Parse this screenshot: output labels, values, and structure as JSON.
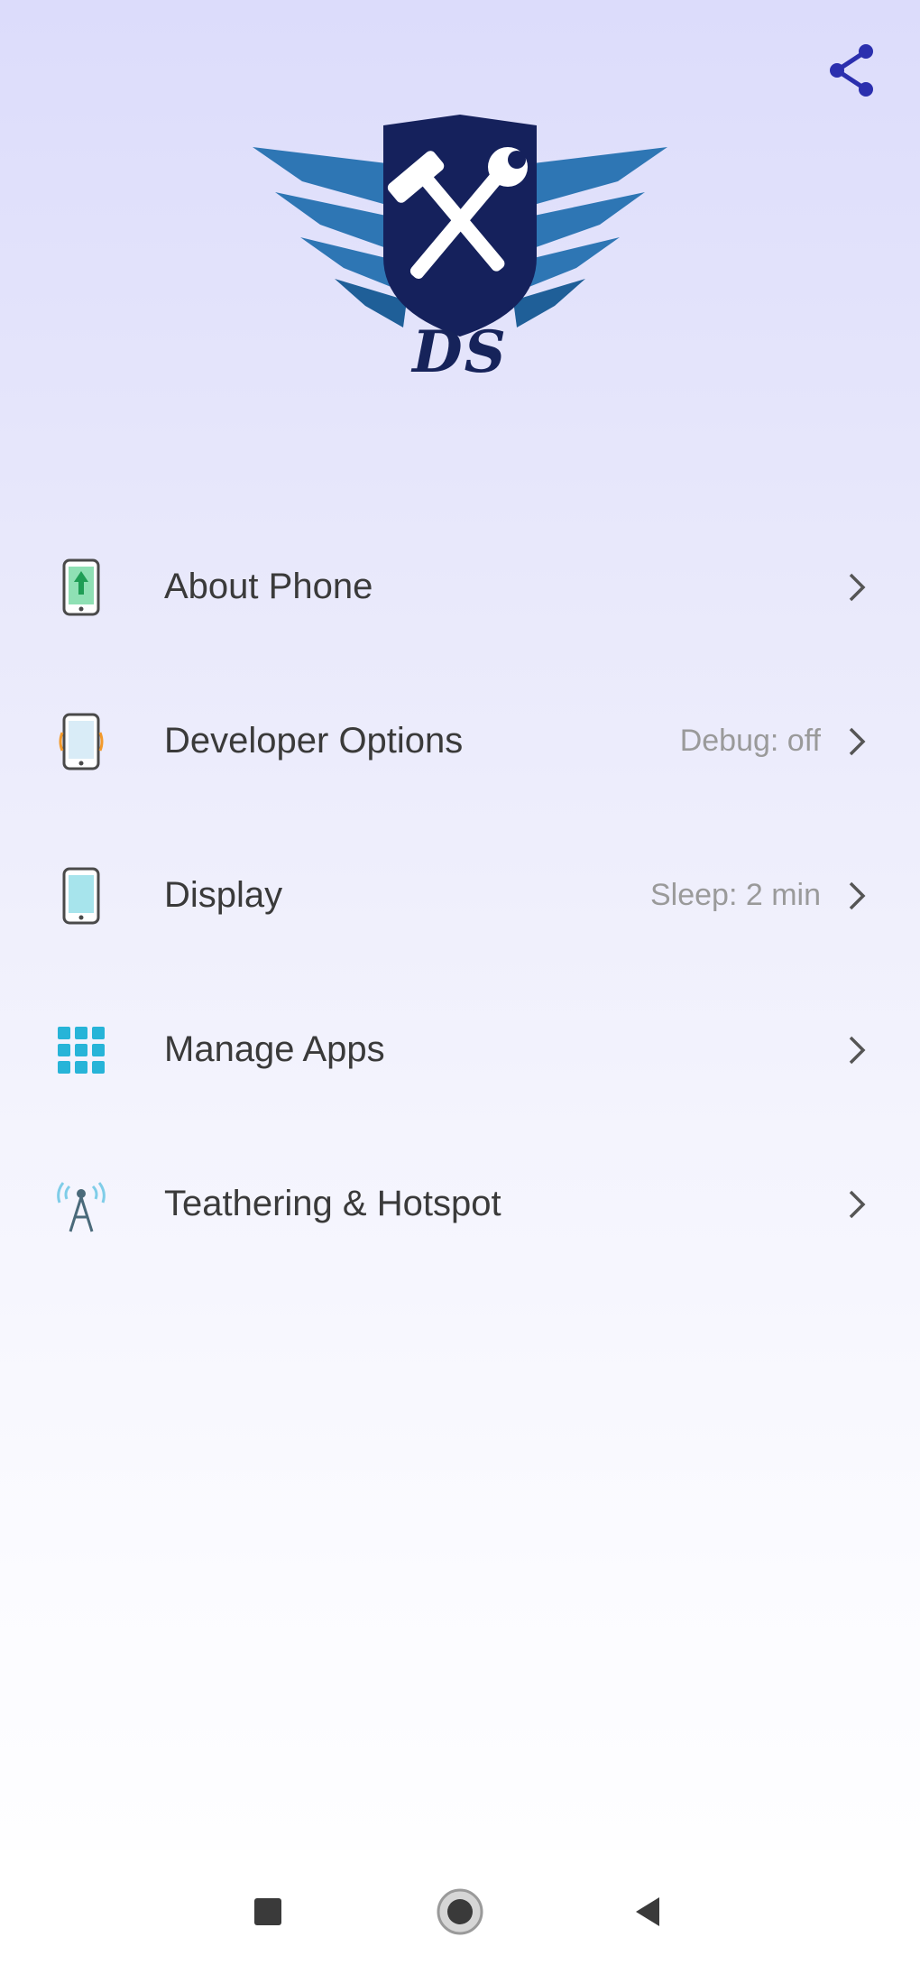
{
  "header": {
    "share_icon": "share-icon"
  },
  "logo": {
    "text": "DS",
    "colors": {
      "shield": "#15215c",
      "wings": "#2e76b4",
      "tools": "#ffffff"
    }
  },
  "menu": {
    "items": [
      {
        "label": "About Phone",
        "value": "",
        "icon": "phone-info-icon"
      },
      {
        "label": "Developer Options",
        "value": "Debug: off",
        "icon": "phone-developer-icon"
      },
      {
        "label": "Display",
        "value": "Sleep: 2 min",
        "icon": "phone-display-icon"
      },
      {
        "label": "Manage Apps",
        "value": "",
        "icon": "app-grid-icon"
      },
      {
        "label": "Teathering & Hotspot",
        "value": "",
        "icon": "hotspot-tower-icon"
      }
    ]
  },
  "navbar": {
    "recents_icon": "square-icon",
    "home_icon": "circle-icon",
    "back_icon": "triangle-back-icon"
  },
  "colors": {
    "accent": "#2b2fae",
    "text": "#3a3a3a",
    "secondary_text": "#9a9a9a"
  }
}
